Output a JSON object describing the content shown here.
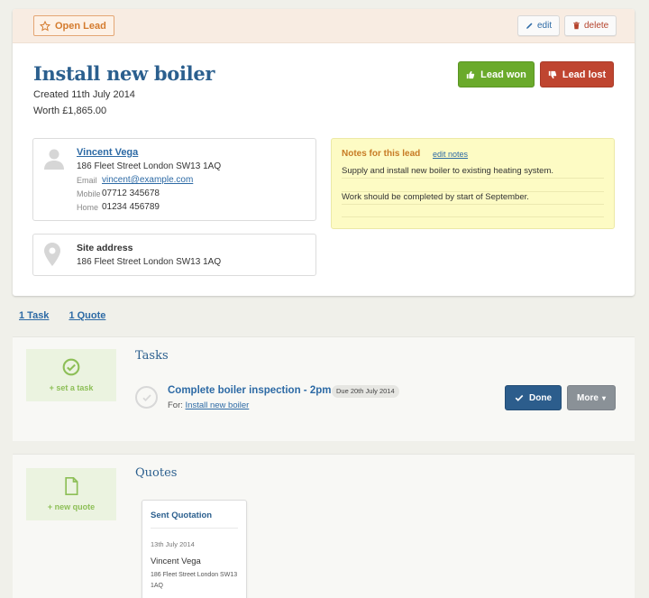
{
  "lead": {
    "status": "Open Lead",
    "edit_label": "edit",
    "delete_label": "delete",
    "title": "Install new boiler",
    "created": "Created 11th July 2014",
    "worth": "Worth £1,865.00",
    "won_label": "Lead won",
    "lost_label": "Lead lost"
  },
  "contact": {
    "name": "Vincent Vega",
    "address": "186 Fleet Street London SW13 1AQ",
    "email_label": "Email",
    "email": "vincent@example.com",
    "mobile_label": "Mobile",
    "mobile": "07712 345678",
    "home_label": "Home",
    "home": "01234 456789"
  },
  "site": {
    "title": "Site address",
    "address": "186 Fleet Street London SW13 1AQ"
  },
  "notes": {
    "title": "Notes for this lead",
    "edit_label": "edit notes",
    "lines": [
      "Supply and install new boiler to existing heating system.",
      "",
      "Work should be completed by start of September.",
      ""
    ]
  },
  "tabs": {
    "tasks": "1 Task",
    "quotes": "1 Quote"
  },
  "tasks": {
    "title": "Tasks",
    "add_label": "+ set a task",
    "item": {
      "title": "Complete boiler inspection - 2pm",
      "due": "Due 20th July 2014",
      "for_label": "For:",
      "for_link": "Install new boiler",
      "done_label": "Done",
      "more_label": "More"
    }
  },
  "quotes": {
    "title": "Quotes",
    "add_label": "+ new quote",
    "card": {
      "title": "Sent Quotation",
      "date": "13th July 2014",
      "name": "Vincent Vega",
      "address": "186 Fleet Street London SW13 1AQ"
    }
  },
  "colors": {
    "primary": "#2b5f8e",
    "won": "#6aaa2b",
    "lost": "#bf4530",
    "notes_bg": "#fdfbc4",
    "open_badge": "#d47b2e"
  }
}
